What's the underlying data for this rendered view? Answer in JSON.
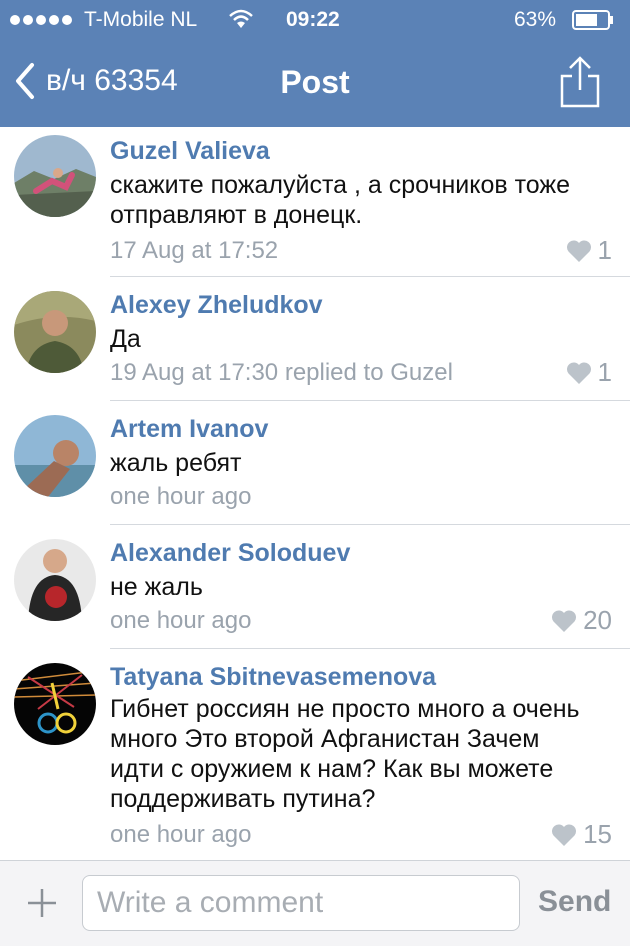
{
  "status_bar": {
    "carrier": "T-Mobile NL",
    "time": "09:22",
    "battery": "63%"
  },
  "nav": {
    "back_label": "в/ч 63354",
    "title": "Post"
  },
  "comments": [
    {
      "author": "Guzel Valieva",
      "text": "скажите пожалуйста , а срочников тоже отправляют в донецк.",
      "meta": "17 Aug at 17:52",
      "likes": "1"
    },
    {
      "author": "Alexey Zheludkov",
      "text": "Да",
      "meta": "19 Aug at 17:30 replied to Guzel",
      "likes": "1"
    },
    {
      "author": "Artem Ivanov",
      "text": "жаль ребят",
      "meta": "one hour ago",
      "likes": ""
    },
    {
      "author": "Alexander Soloduev",
      "text": "не жаль",
      "meta": "one hour ago",
      "likes": "20"
    },
    {
      "author": "Tatyana Sbitnevasemenova",
      "text": "Гибнет россиян не просто много а очень много  Это второй Афганистан Зачем идти с оружием к нам? Как вы можете  поддерживать путина?",
      "meta": "one hour ago",
      "likes": "15"
    }
  ],
  "composer": {
    "placeholder": "Write a comment",
    "send_label": "Send"
  },
  "icons": {
    "back": "chevron-left-icon",
    "share": "share-icon",
    "like": "heart-icon",
    "add": "plus-icon"
  },
  "colors": {
    "header": "#5b82b6",
    "author": "#4f7bb0",
    "meta": "#9aa3ad"
  }
}
